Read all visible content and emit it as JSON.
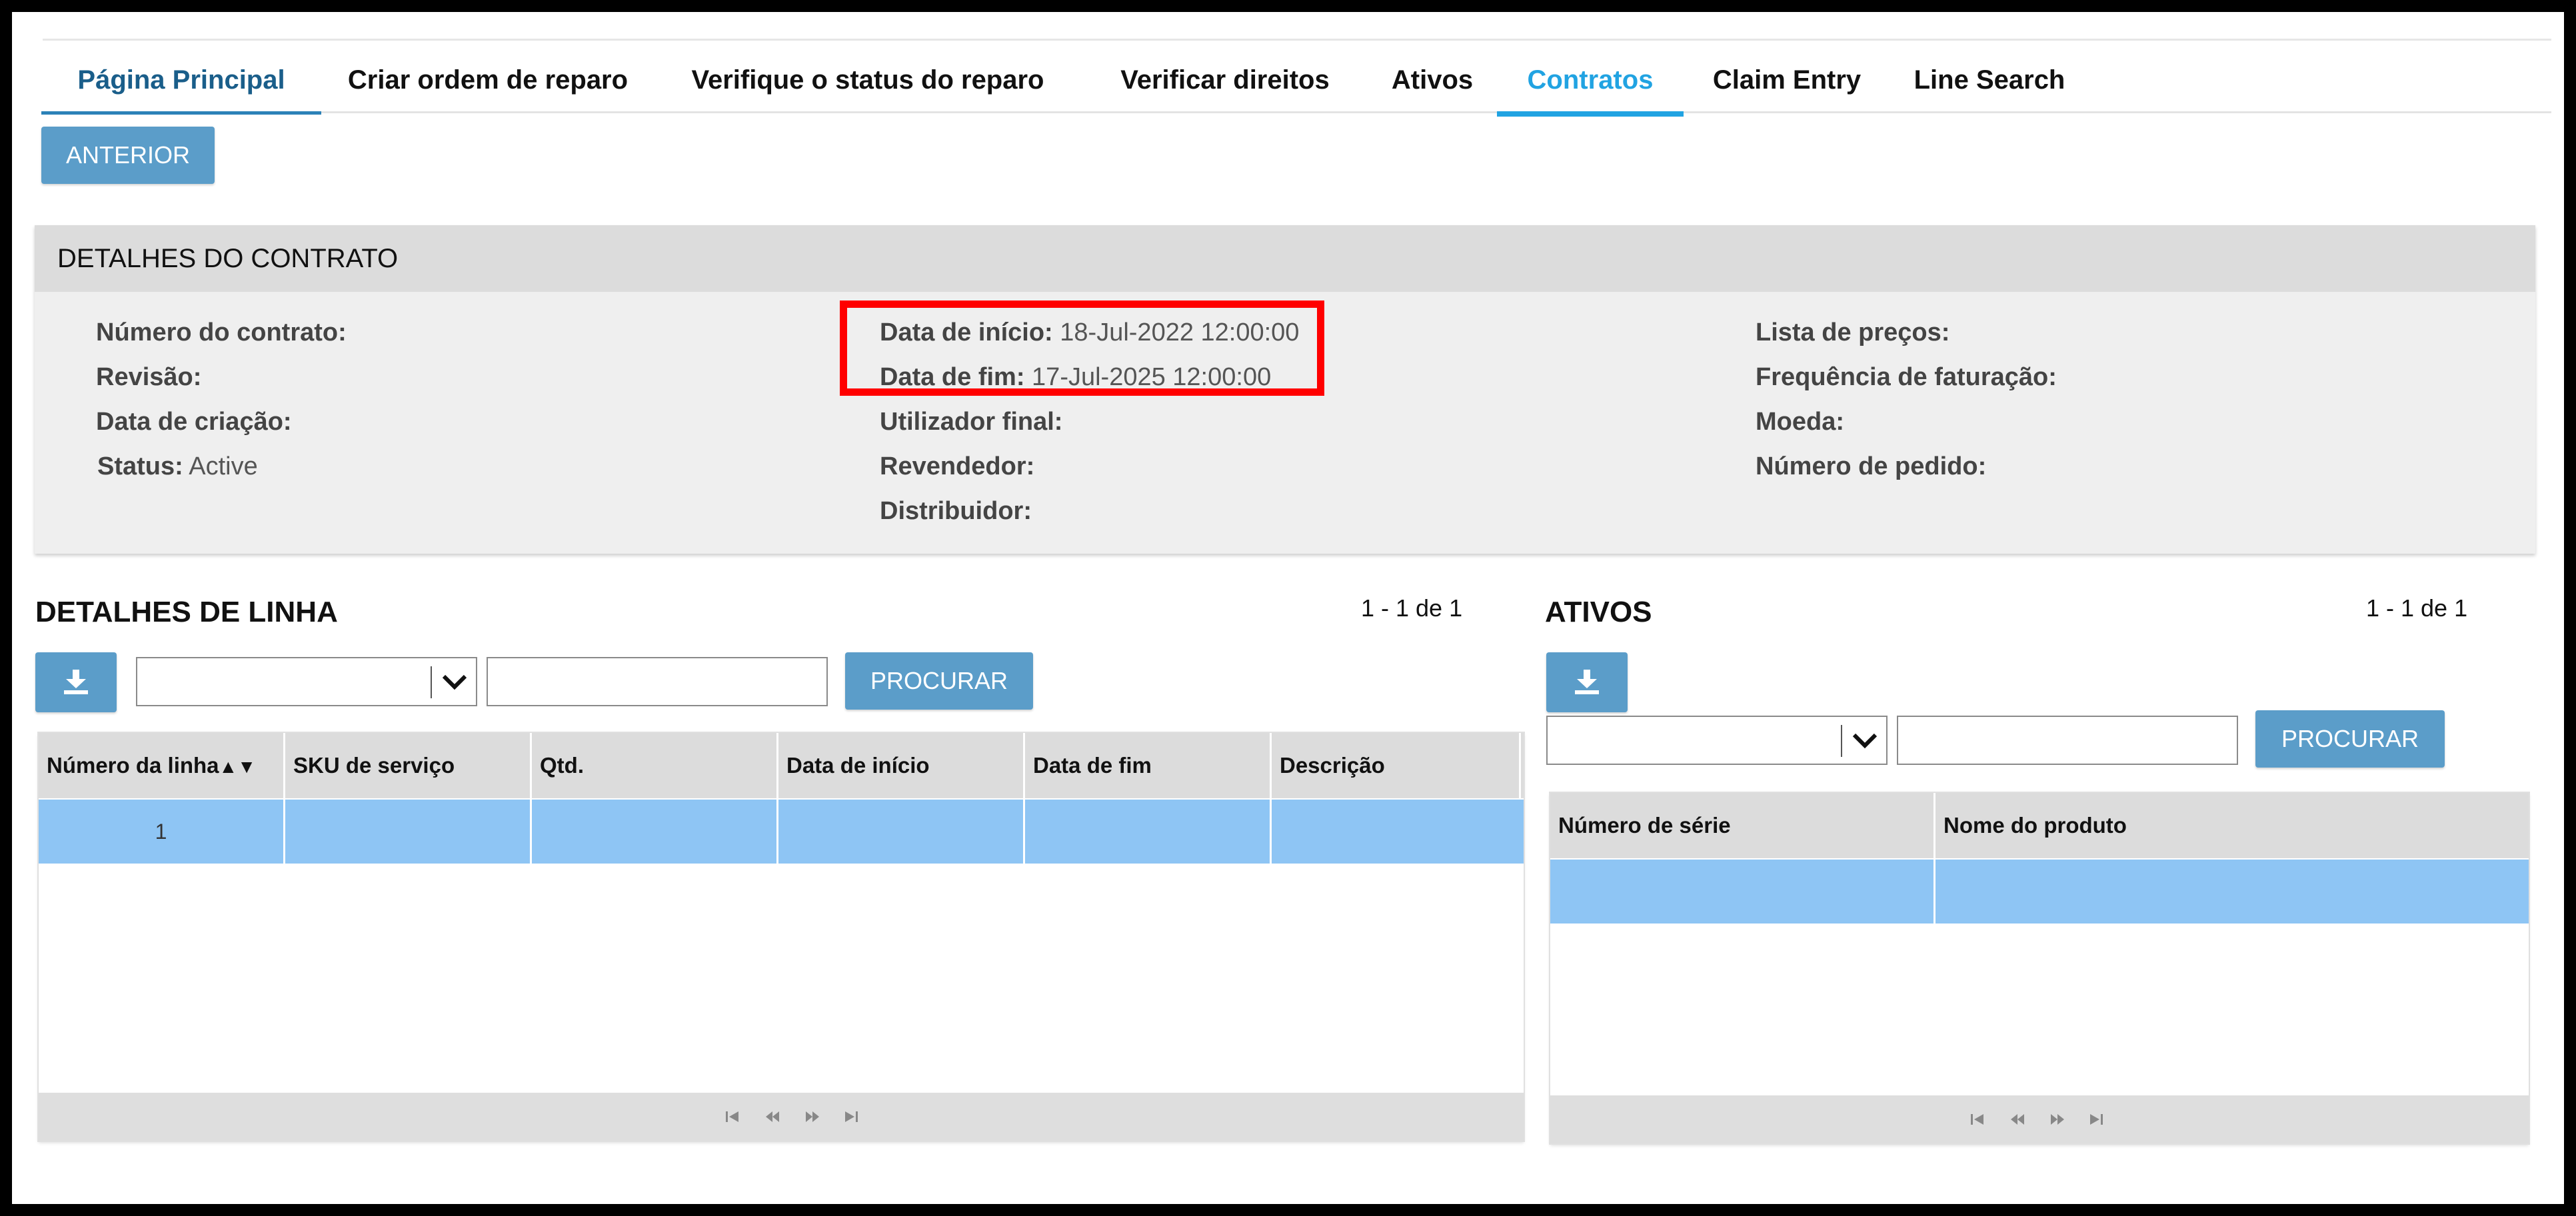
{
  "tabs": [
    {
      "label": "Página Principal"
    },
    {
      "label": "Criar ordem de reparo"
    },
    {
      "label": "Verifique o status do reparo"
    },
    {
      "label": "Verificar direitos"
    },
    {
      "label": "Ativos"
    },
    {
      "label": "Contratos"
    },
    {
      "label": "Claim Entry"
    },
    {
      "label": "Line Search"
    }
  ],
  "active_tab": "Contratos",
  "prev_button": "ANTERIOR",
  "contract": {
    "title": "DETALHES DO CONTRATO",
    "col1": [
      {
        "label": "Número do contrato:",
        "value": ""
      },
      {
        "label": "Revisão:",
        "value": ""
      },
      {
        "label": "Data de criação:",
        "value": ""
      },
      {
        "label": "Status:",
        "value": "Active"
      }
    ],
    "col2": [
      {
        "label": "Data de início:",
        "value": "18-Jul-2022 12:00:00"
      },
      {
        "label": "Data de fim:",
        "value": "17-Jul-2025 12:00:00"
      },
      {
        "label": "Utilizador final:",
        "value": ""
      },
      {
        "label": "Revendedor:",
        "value": ""
      },
      {
        "label": "Distribuidor:",
        "value": ""
      }
    ],
    "col3": [
      {
        "label": "Lista de preços:",
        "value": ""
      },
      {
        "label": "Frequência de faturação:",
        "value": ""
      },
      {
        "label": "Moeda:",
        "value": ""
      },
      {
        "label": "Número de pedido:",
        "value": ""
      }
    ]
  },
  "line_details": {
    "title": "DETALHES DE LINHA",
    "count": "1 - 1 de 1",
    "search_button": "PROCURAR",
    "select_value": "",
    "input_value": "",
    "columns": [
      "Número da linha",
      "SKU de serviço",
      "Qtd.",
      "Data de início",
      "Data de fim",
      "Descrição"
    ],
    "sort_indicator": "▲▼",
    "rows": [
      [
        "1",
        "",
        "",
        "",
        "",
        ""
      ]
    ]
  },
  "assets": {
    "title": "ATIVOS",
    "count": "1 - 1 de 1",
    "search_button": "PROCURAR",
    "select_value": "",
    "input_value": "",
    "columns": [
      "Número de série",
      "Nome do produto"
    ],
    "rows": [
      [
        "",
        ""
      ]
    ]
  },
  "colors": {
    "accent": "#21a3e2",
    "button": "#5b9dc9",
    "selected_row": "#8ec5f4",
    "highlight_box": "#ff0000"
  },
  "icons": [
    "download-icon",
    "chevron-down-icon",
    "first-page-icon",
    "prev-page-icon",
    "next-page-icon",
    "last-page-icon"
  ]
}
